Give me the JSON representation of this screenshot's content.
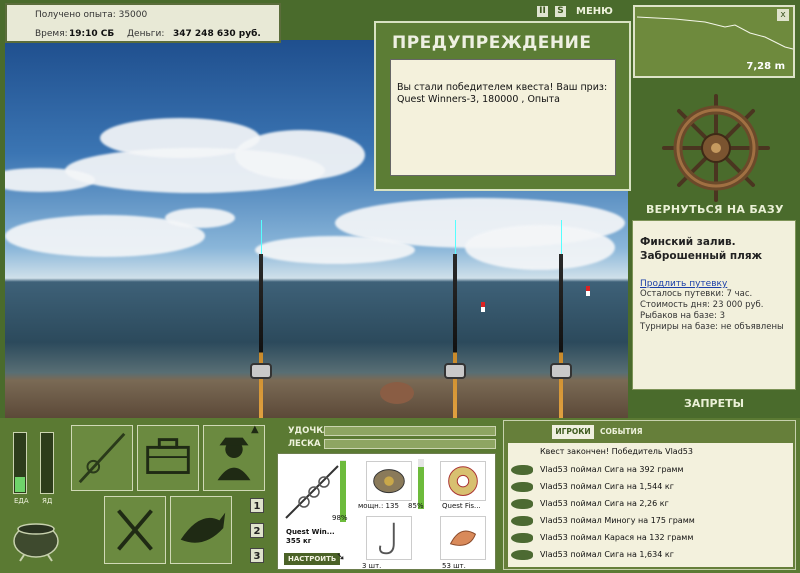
{
  "info": {
    "xp_label": "Получено опыта: 35000",
    "time_label": "Время:",
    "time_value": "19:10 СБ",
    "money_label": "Деньги:",
    "money_value": "347 248 630 руб."
  },
  "warning": {
    "title": "ПРЕДУПРЕЖДЕНИЕ",
    "message": "Вы стали победителем квеста! Ваш приз: Quest Winners-3, 180000 , Опыта"
  },
  "top_controls": {
    "pause": "II",
    "sound": "S",
    "menu": "МЕНЮ"
  },
  "depth": {
    "value": "7,28 m",
    "close": "x"
  },
  "back_to_base": "ВЕРНУТЬСЯ НА БАЗУ",
  "location": {
    "title": "Финский залив. Заброшенный пляж",
    "extend_link": "Продлить путевку",
    "remaining": "Осталось путевки: 7 час.",
    "day_cost": "Стоимость дня: 23 000 руб.",
    "fishers": "Рыбаков на базе: 3",
    "tournaments": "Турниры на базе: не объявлены"
  },
  "bans": "ЗАПРЕТЫ",
  "meters": {
    "food_label": "ЕДА",
    "poison_label": "ЯД",
    "food_level": 0.25,
    "poison_level": 0.0
  },
  "slot_pages": [
    "1",
    "2",
    "3"
  ],
  "tackle": {
    "rod_label": "УДОЧКА",
    "line_label": "ЛЕСКА",
    "rod_name": "Quest Win...",
    "rod_weight": "355 кг",
    "rod_pct": "98%",
    "reel_name": "мощн.: 135",
    "reel_pct": "85%",
    "line_name": "Quest Fis...",
    "hook_count": "3 шт.",
    "bait_count": "53 шт.",
    "tune": "НАСТРОИТЬ"
  },
  "events": {
    "tab_players": "ИГРОКИ",
    "tab_events": "СОБЫТИЯ",
    "header": "Квест закончен! Победитель Vlad53",
    "rows": [
      "Vlad53 поймал Сига на 392 грамм",
      "Vlad53 поймал Сига на 1,544 кг",
      "Vlad53 поймал Сига на 2,26 кг",
      "Vlad53 поймал Миногу на 175 грамм",
      "Vlad53 поймал Карася на 132 грамм",
      "Vlad53 поймал Сига на 1,634 кг"
    ]
  },
  "colors": {
    "panel_green": "#5b7a33",
    "cream": "#f2f0dc",
    "accent_text": "#eaf0d6"
  }
}
